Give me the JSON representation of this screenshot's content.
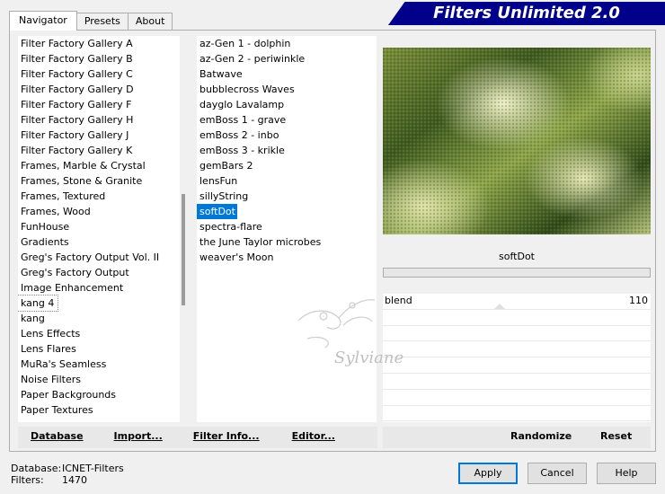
{
  "tabs": [
    {
      "label": "Navigator"
    },
    {
      "label": "Presets"
    },
    {
      "label": "About"
    }
  ],
  "banner_title": "Filters Unlimited 2.0",
  "categories": [
    "Filter Factory Gallery A",
    "Filter Factory Gallery B",
    "Filter Factory Gallery C",
    "Filter Factory Gallery D",
    "Filter Factory Gallery F",
    "Filter Factory Gallery H",
    "Filter Factory Gallery J",
    "Filter Factory Gallery K",
    "Frames, Marble & Crystal",
    "Frames, Stone & Granite",
    "Frames, Textured",
    "Frames, Wood",
    "FunHouse",
    "Gradients",
    "Greg's Factory Output Vol. II",
    "Greg's Factory Output",
    "Image Enhancement",
    "kang 4",
    "kang",
    "Lens Effects",
    "Lens Flares",
    "MuRa's Seamless",
    "Noise Filters",
    "Paper Backgrounds",
    "Paper Textures"
  ],
  "focused_category": "kang 4",
  "filters": [
    "az-Gen 1  -  dolphin",
    "az-Gen 2  -  periwinkle",
    "Batwave",
    "bubblecross Waves",
    "dayglo Lavalamp",
    "emBoss 1  -  grave",
    "emBoss 2  -  inbo",
    "emBoss 3  -  krikle",
    "gemBars 2",
    "lensFun",
    "sillyString",
    "softDot",
    "spectra-flare",
    "the June Taylor microbes",
    "weaver's Moon"
  ],
  "selected_filter": "softDot",
  "filter_name": "softDot",
  "progress": 0,
  "parameters": [
    {
      "label": "blend",
      "value": "110"
    }
  ],
  "empty_parameter_rows": 7,
  "toolbar": {
    "database": "Database",
    "import": "Import...",
    "filter_info": "Filter Info...",
    "editor": "Editor...",
    "randomize": "Randomize",
    "reset": "Reset"
  },
  "status": {
    "database_label": "Database:",
    "database_value": "ICNET-Filters",
    "filters_label": "Filters:",
    "filters_value": "1470"
  },
  "buttons": {
    "apply": "Apply",
    "cancel": "Cancel",
    "help": "Help"
  },
  "watermark_text": "Sylviane",
  "colors": {
    "selection": "#0078d7",
    "banner": "#00008b"
  }
}
